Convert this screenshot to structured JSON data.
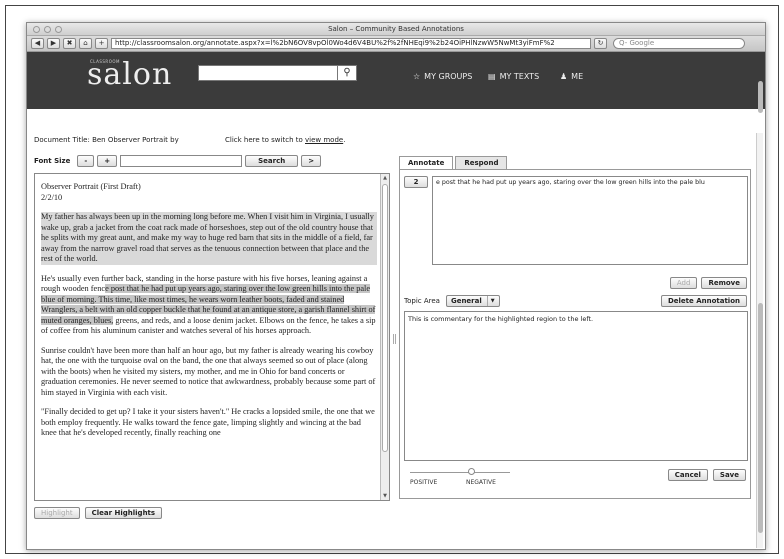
{
  "window": {
    "title": "Salon – Community Based Annotations"
  },
  "browser": {
    "url": "http://classroomsalon.org/annotate.aspx?x=l%2bN6OV8vpOl0Wo4d6V4BU%2f%2fNHEqi9%2b24OiPHlNzwW5NwMt3yiFmF%2",
    "search_placeholder": "Q- Google",
    "back": "◀",
    "forward": "▶",
    "stop": "✖",
    "home": "⌂",
    "add": "+",
    "reload": "↻"
  },
  "header": {
    "logo_small": "CLASSROOM",
    "logo": "salon",
    "search_icon": "⚲",
    "nav": [
      {
        "icon": "☆",
        "label": "MY GROUPS"
      },
      {
        "icon": "▤",
        "label": "MY TEXTS"
      },
      {
        "icon": "♟",
        "label": "ME"
      }
    ]
  },
  "document": {
    "title_label": "Document Title: Ben Observer Portrait by",
    "switch_text": "Click here to switch to",
    "switch_link": "view mode",
    "switch_end": "."
  },
  "fontbar": {
    "label": "Font Size",
    "minus": "-",
    "plus": "+",
    "search": "Search",
    "next": ">"
  },
  "reading": {
    "heading": "Observer Portrait (First Draft)",
    "date": "2/2/10",
    "p1": "My father has always been up in the morning long before me. When I visit him in Virginia, I usually wake up, grab a jacket from the coat rack made of horseshoes, step out of the old country house that he splits with my great aunt, and make my way to huge red barn that sits in the middle of a field, far away from the narrow gravel road that serves as the tenuous connection between that place and the rest of the world.",
    "p2a": "He's usually even further back, standing in the horse pasture with his five horses, leaning against a rough wooden fenc",
    "p2b": "e post that he had put up years ago, staring over the low green hills into the pale blue of morning. This time, like most times, he wears worn leather boots, faded and stained Wranglers, a belt with an old copper buckle that he found at an antique store, a garish flannel shirt of muted oranges, blues,",
    "p2c": " greens, and reds, and a loose denim jacket. Elbows on the fence, he takes a sip of coffee from his aluminum canister and watches several of his horses approach.",
    "p3": "Sunrise couldn't have been more than half an hour ago, but my father is already wearing his cowboy hat, the one with the turquoise oval on the band, the one that always seemed so out of place (along with the boots) when he visited my sisters, my mother, and me in Ohio for band concerts or graduation ceremonies. He never seemed to notice that awkwardness, probably because some part of him stayed in Virginia with each visit.",
    "p4": "\"Finally decided to get up? I take it your sisters haven't.\" He cracks a lopsided smile, the one that we both employ frequently. He walks toward the fence gate, limping slightly and wincing at the bad knee that he's developed recently, finally reaching one"
  },
  "bottom_buttons": {
    "highlight": "Highlight",
    "clear": "Clear Highlights"
  },
  "tabs": [
    "Annotate",
    "Respond"
  ],
  "annotation": {
    "number": "2",
    "quote": "e post that he had put up years ago, staring over the low green hills into the pale blu",
    "add": "Add",
    "remove": "Remove",
    "topic_label": "Topic Area",
    "topic_value": "General",
    "topic_arrow": "▼",
    "delete": "Delete Annotation",
    "comment": "This is commentary for the highlighted region to the left.",
    "slider_positive": "POSITIVE",
    "slider_negative": "NEGATIVE",
    "cancel": "Cancel",
    "save": "Save"
  }
}
